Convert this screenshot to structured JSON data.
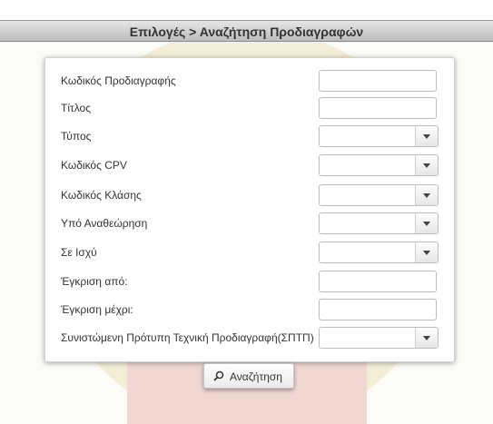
{
  "header": {
    "title": "Επιλογές > Αναζήτηση Προδιαγραφών"
  },
  "form": {
    "fields": [
      {
        "label": "Κωδικός Προδιαγραφής",
        "type": "text",
        "value": ""
      },
      {
        "label": "Τίτλος",
        "type": "text",
        "value": ""
      },
      {
        "label": "Τύπος",
        "type": "select",
        "value": ""
      },
      {
        "label": "Κωδικός CPV",
        "type": "select",
        "value": ""
      },
      {
        "label": "Κωδικός Κλάσης",
        "type": "select",
        "value": ""
      },
      {
        "label": "Υπό Αναθεώρηση",
        "type": "select",
        "value": ""
      },
      {
        "label": "Σε Ισχύ",
        "type": "select",
        "value": ""
      },
      {
        "label": "Έγκριση από:",
        "type": "text",
        "value": ""
      },
      {
        "label": "Έγκριση μέχρι:",
        "type": "text",
        "value": ""
      },
      {
        "label": "Συνιστώμενη Πρότυπη Τεχνική Προδιαγραφή(ΣΠΤΠ)",
        "type": "select",
        "value": ""
      }
    ]
  },
  "search_button": {
    "label": "Αναζήτηση",
    "icon": "search-icon"
  },
  "colors": {
    "header_bg": "#cfcfcf",
    "watermark_red": "#c0392b",
    "watermark_yellow": "#e9c46a"
  }
}
